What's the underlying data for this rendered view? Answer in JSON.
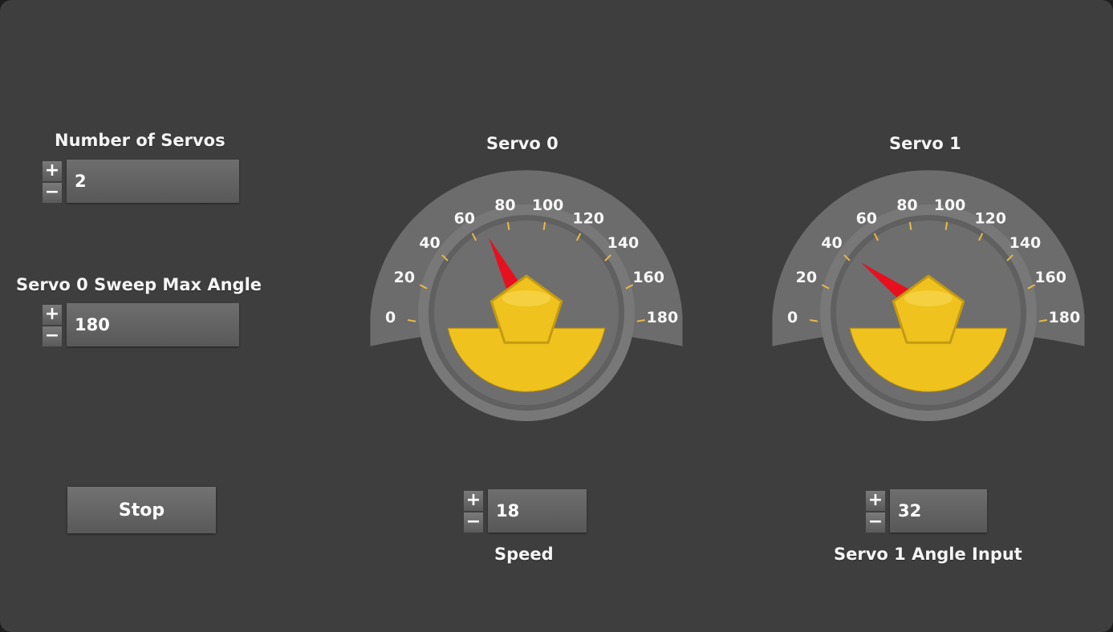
{
  "controls": {
    "num_servos": {
      "label": "Number of Servos",
      "value": "2"
    },
    "sweep_max": {
      "label": "Servo 0 Sweep Max Angle",
      "value": "180"
    },
    "stop_label": "Stop",
    "speed": {
      "label": "Speed",
      "value": "18"
    },
    "angle_input": {
      "label": "Servo 1 Angle Input",
      "value": "32"
    },
    "plus_symbol": "+",
    "minus_symbol": "−"
  },
  "gauges": [
    {
      "title": "Servo 0",
      "value": 60
    },
    {
      "title": "Servo 1",
      "value": 30
    }
  ],
  "scale": {
    "min": 0,
    "max": 180,
    "labels": [
      "0",
      "20",
      "40",
      "60",
      "80",
      "100",
      "120",
      "140",
      "160",
      "180"
    ]
  },
  "colors": {
    "needle": "#e8101e",
    "knob": "#f0c21e",
    "ticks": "#e8b84a",
    "bezel": "#787878"
  }
}
